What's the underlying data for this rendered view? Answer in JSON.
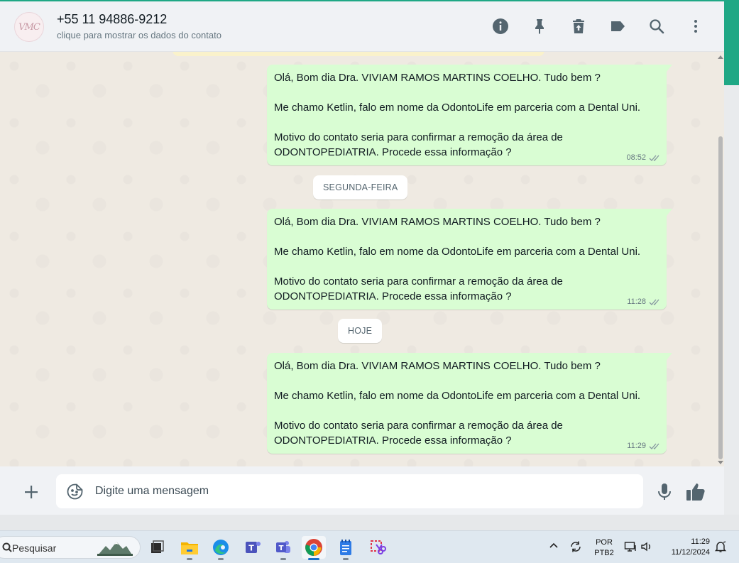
{
  "contact": {
    "avatar_text": "VMC",
    "name": "+55 11 94886-9212",
    "subtitle": "clique para mostrar os dados do contato"
  },
  "header_icons": [
    "info-icon",
    "pin-icon",
    "trash-icon",
    "label-icon",
    "search-icon",
    "more-icon"
  ],
  "messages": [
    {
      "line1": "Olá, Bom dia Dra. VIVIAM RAMOS MARTINS COELHO. Tudo bem ?",
      "line2": "Me chamo Ketlin, falo em nome da OdontoLife em parceria com a Dental Uni.",
      "line3": "Motivo do contato seria para confirmar a remoção da área de",
      "line4": "ODONTOPEDIATRIA. Procede essa informação ?",
      "time": "08:52",
      "status": "double-check-icon"
    },
    {
      "line1": "Olá, Bom dia Dra. VIVIAM RAMOS MARTINS COELHO. Tudo bem ?",
      "line2": "Me chamo Ketlin, falo em nome da OdontoLife em parceria com a Dental Uni.",
      "line3": "Motivo do contato seria para confirmar a remoção da área de",
      "line4": "ODONTOPEDIATRIA. Procede essa informação ?",
      "time": "11:28",
      "status": "double-check-icon"
    },
    {
      "line1": "Olá, Bom dia Dra. VIVIAM RAMOS MARTINS COELHO. Tudo bem ?",
      "line2": "Me chamo Ketlin, falo em nome da OdontoLife em parceria com a Dental Uni.",
      "line3": "Motivo do contato seria para confirmar a remoção da área de",
      "line4": "ODONTOPEDIATRIA. Procede essa informação ?",
      "time": "11:29",
      "status": "double-check-icon"
    }
  ],
  "date_separators": {
    "first": "SEGUNDA-FEIRA",
    "second": "HOJE"
  },
  "compose": {
    "placeholder": "Digite uma mensagem"
  },
  "taskbar": {
    "search_label": "Pesquisar",
    "apps": [
      "task-view-icon",
      "file-explorer-icon",
      "edge-icon",
      "teams-classic-icon",
      "teams-icon",
      "chrome-icon",
      "notepad-icon",
      "snipping-tool-icon"
    ],
    "active_app": "chrome-icon",
    "lang_line1": "POR",
    "lang_line2": "PTB2",
    "time": "11:29",
    "date": "11/12/2024"
  },
  "colors": {
    "accent": "#1fa885",
    "bubble_out": "#d9fdd3",
    "chat_bg": "#efeae2",
    "header_bg": "#f0f2f5"
  }
}
